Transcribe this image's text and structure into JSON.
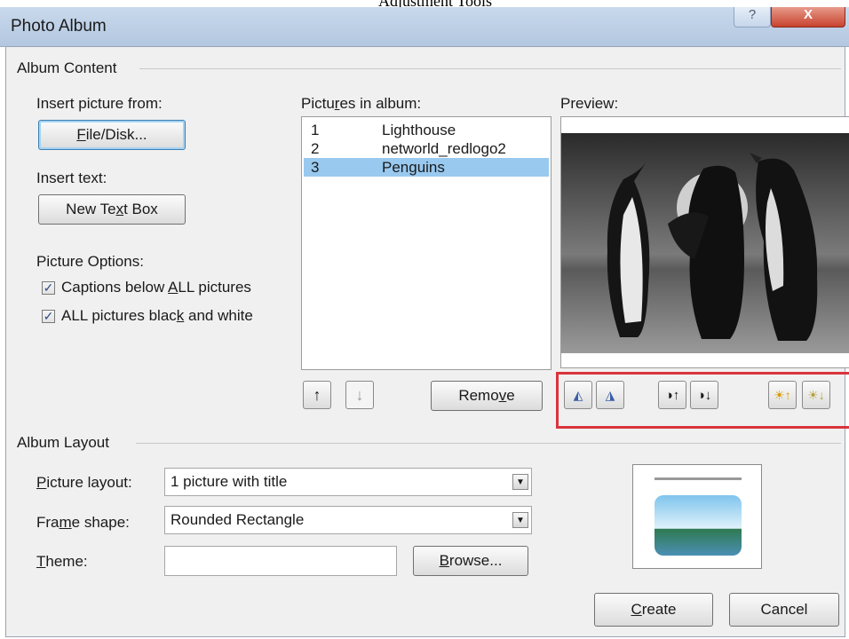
{
  "caption": "Adjustment Tools",
  "window": {
    "title": "Photo Album",
    "help": "?",
    "close": "X"
  },
  "album_content": {
    "label": "Album Content",
    "insert_picture_label": "Insert picture from:",
    "file_disk_button": {
      "pre": "",
      "ul": "F",
      "post": "ile/Disk..."
    },
    "insert_text_label": "Insert text:",
    "new_text_box_button": {
      "pre": "New Te",
      "ul": "x",
      "post": "t Box"
    },
    "picture_options_label": "Picture Options:",
    "options": [
      {
        "pre": "Captions below ",
        "ul": "A",
        "post": "LL pictures",
        "checked": true
      },
      {
        "pre": "ALL pictures blac",
        "ul": "k",
        "post": " and white",
        "checked": true
      }
    ],
    "pictures_label": {
      "pre": "Pictu",
      "ul": "r",
      "post": "es in album:"
    },
    "pictures": [
      {
        "num": "1",
        "name": "Lighthouse",
        "selected": false
      },
      {
        "num": "2",
        "name": "networld_redlogo2",
        "selected": false
      },
      {
        "num": "3",
        "name": "Penguins",
        "selected": true
      }
    ],
    "move_up_icon": "arrow-up",
    "move_down_icon": "arrow-down",
    "remove_button": {
      "pre": "Remo",
      "ul": "v",
      "post": "e"
    },
    "preview_label": "Preview:",
    "adjust_tools": [
      "rotate-left-icon",
      "rotate-right-icon",
      "contrast-up-icon",
      "contrast-down-icon",
      "brightness-up-icon",
      "brightness-down-icon"
    ]
  },
  "album_layout": {
    "label": "Album Layout",
    "picture_layout_label": {
      "pre": "",
      "ul": "P",
      "post": "icture layout:"
    },
    "picture_layout_value": "1 picture with title",
    "frame_shape_label": {
      "pre": "Fra",
      "ul": "m",
      "post": "e shape:"
    },
    "frame_shape_value": "Rounded Rectangle",
    "theme_label": {
      "pre": "",
      "ul": "T",
      "post": "heme:"
    },
    "theme_value": "",
    "browse_button": {
      "pre": "",
      "ul": "B",
      "post": "rowse..."
    }
  },
  "footer": {
    "create_button": {
      "pre": "",
      "ul": "C",
      "post": "reate"
    },
    "cancel_button": "Cancel"
  },
  "colors": {
    "selection": "#99c9ef",
    "highlight_box": "#d9343d",
    "title_bar": "#c3d4ea"
  }
}
